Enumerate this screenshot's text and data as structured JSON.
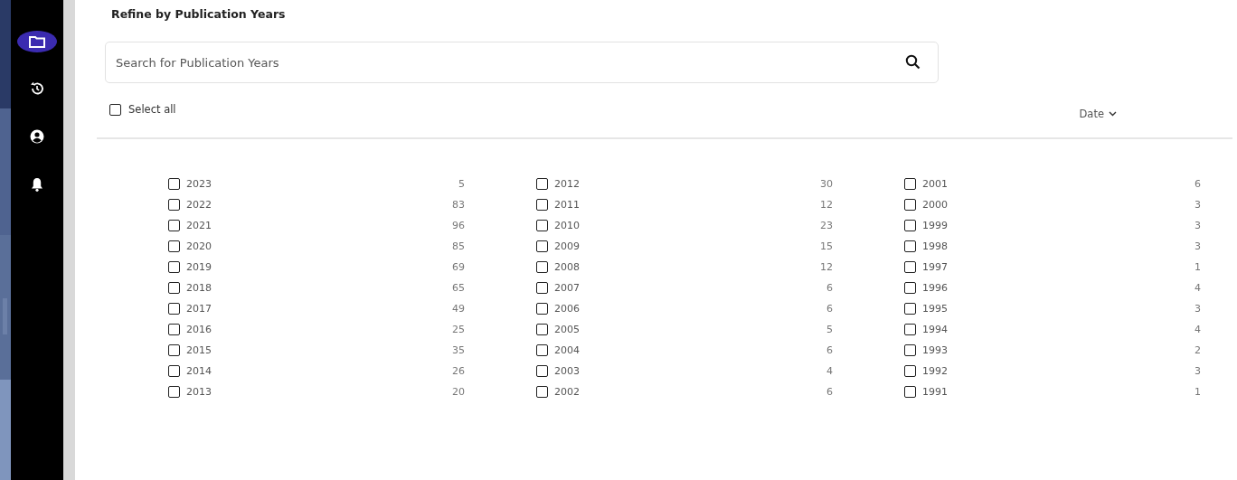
{
  "sidebar": {
    "items": [
      {
        "kind": "folder",
        "selected": true
      },
      {
        "kind": "history",
        "selected": false
      },
      {
        "kind": "account",
        "selected": false
      },
      {
        "kind": "bell",
        "selected": false
      }
    ]
  },
  "title": "Refine by Publication Years",
  "search": {
    "placeholder": "Search for Publication Years"
  },
  "select_all": {
    "label": "Select all",
    "checked": false
  },
  "sort": {
    "label": "Date"
  },
  "years": [
    {
      "label": "2023",
      "count": "5",
      "checked": false
    },
    {
      "label": "2022",
      "count": "83",
      "checked": false
    },
    {
      "label": "2021",
      "count": "96",
      "checked": false
    },
    {
      "label": "2020",
      "count": "85",
      "checked": false
    },
    {
      "label": "2019",
      "count": "69",
      "checked": false
    },
    {
      "label": "2018",
      "count": "65",
      "checked": false
    },
    {
      "label": "2017",
      "count": "49",
      "checked": false
    },
    {
      "label": "2016",
      "count": "25",
      "checked": false
    },
    {
      "label": "2015",
      "count": "35",
      "checked": false
    },
    {
      "label": "2014",
      "count": "26",
      "checked": false
    },
    {
      "label": "2013",
      "count": "20",
      "checked": false
    },
    {
      "label": "2012",
      "count": "30",
      "checked": false
    },
    {
      "label": "2011",
      "count": "12",
      "checked": false
    },
    {
      "label": "2010",
      "count": "23",
      "checked": false
    },
    {
      "label": "2009",
      "count": "15",
      "checked": false
    },
    {
      "label": "2008",
      "count": "12",
      "checked": false
    },
    {
      "label": "2007",
      "count": "6",
      "checked": false
    },
    {
      "label": "2006",
      "count": "6",
      "checked": false
    },
    {
      "label": "2005",
      "count": "5",
      "checked": false
    },
    {
      "label": "2004",
      "count": "6",
      "checked": false
    },
    {
      "label": "2003",
      "count": "4",
      "checked": false
    },
    {
      "label": "2002",
      "count": "6",
      "checked": false
    },
    {
      "label": "2001",
      "count": "6",
      "checked": false
    },
    {
      "label": "2000",
      "count": "3",
      "checked": false
    },
    {
      "label": "1999",
      "count": "3",
      "checked": false
    },
    {
      "label": "1998",
      "count": "3",
      "checked": false
    },
    {
      "label": "1997",
      "count": "1",
      "checked": false
    },
    {
      "label": "1996",
      "count": "4",
      "checked": false
    },
    {
      "label": "1995",
      "count": "3",
      "checked": false
    },
    {
      "label": "1994",
      "count": "4",
      "checked": false
    },
    {
      "label": "1993",
      "count": "2",
      "checked": false
    },
    {
      "label": "1992",
      "count": "3",
      "checked": false
    },
    {
      "label": "1991",
      "count": "1",
      "checked": false
    }
  ]
}
